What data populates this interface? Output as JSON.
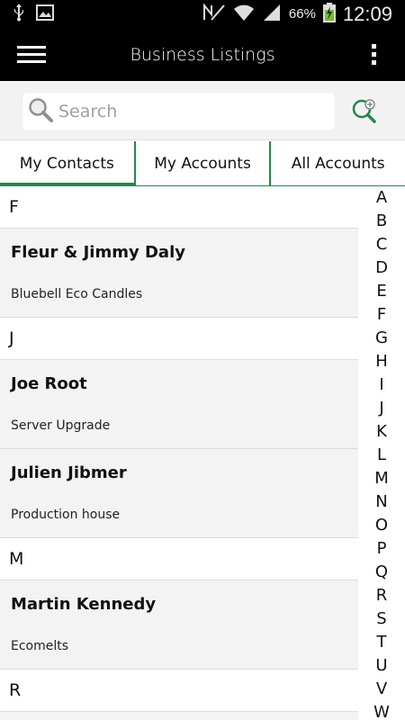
{
  "status_bar": {
    "icons": [
      "usb-icon",
      "image-icon",
      "nfc-icon",
      "wifi-icon",
      "signal-icon",
      "battery-charging-icon"
    ],
    "battery": "66%",
    "time": "12:09"
  },
  "app_bar": {
    "title": "Business Listings"
  },
  "search": {
    "placeholder": "Search"
  },
  "tabs": [
    {
      "label": "My Contacts",
      "active": true
    },
    {
      "label": "My Accounts",
      "active": false
    },
    {
      "label": "All Accounts",
      "active": false
    }
  ],
  "list": {
    "sections": [
      {
        "letter": "F",
        "contacts": [
          {
            "name": "Fleur & Jimmy Daly",
            "company": "Bluebell Eco Candles"
          }
        ]
      },
      {
        "letter": "J",
        "contacts": [
          {
            "name": "Joe Root",
            "company": "Server Upgrade"
          },
          {
            "name": "Julien Jibmer",
            "company": "Production house"
          }
        ]
      },
      {
        "letter": "M",
        "contacts": [
          {
            "name": "Martin Kennedy",
            "company": "Ecomelts"
          }
        ]
      },
      {
        "letter": "R",
        "contacts": []
      }
    ]
  },
  "alphabet_index": [
    "A",
    "B",
    "C",
    "D",
    "E",
    "F",
    "G",
    "H",
    "I",
    "J",
    "K",
    "L",
    "M",
    "N",
    "O",
    "P",
    "Q",
    "R",
    "S",
    "T",
    "U",
    "V",
    "W"
  ],
  "colors": {
    "accent": "#23884c",
    "app_bar": "#000000",
    "list_bg": "#f3f3f3"
  }
}
